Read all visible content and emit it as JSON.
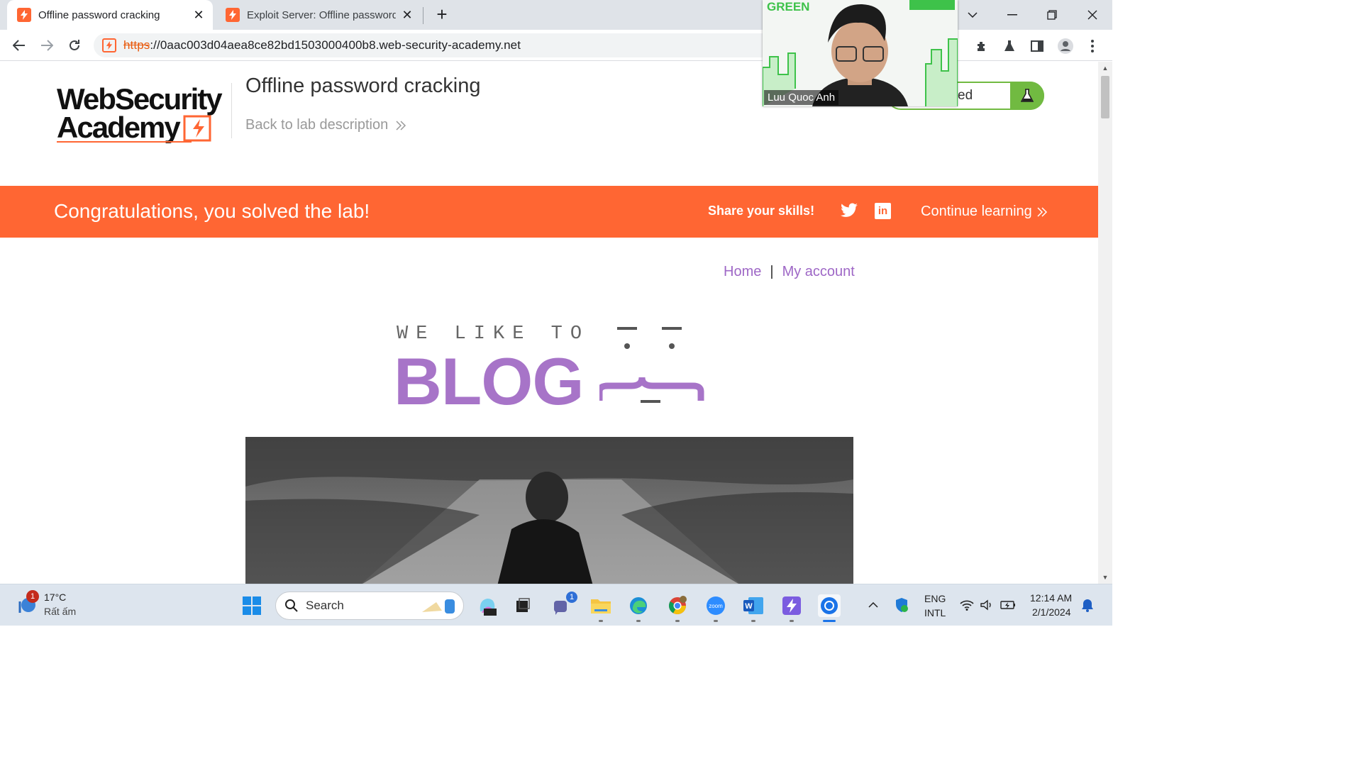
{
  "browser": {
    "tabs": [
      {
        "title": "Offline password cracking",
        "active": true
      },
      {
        "title": "Exploit Server: Offline password c",
        "active": false
      }
    ],
    "url_scheme": "https",
    "url_rest": "://0aac003d04aea8ce82bd1503000400b8.web-security-academy.net"
  },
  "header": {
    "logo_line1": "WebSecurity",
    "logo_line2": "Academy",
    "lab_title": "Offline password cracking",
    "back_link": "Back to lab description",
    "status_label": "ed"
  },
  "banner": {
    "message": "Congratulations, you solved the lab!",
    "share": "Share your skills!",
    "linkedin": "in",
    "continue": "Continue learning"
  },
  "nav": {
    "home": "Home",
    "separator": "|",
    "account": "My account"
  },
  "blog": {
    "tagline": "WE LIKE TO",
    "word": "BLOG"
  },
  "webcam": {
    "name": "Luu Quoc Anh",
    "logo": "GREEN"
  },
  "taskbar": {
    "weather_temp": "17°C",
    "weather_desc": "Rất ấm",
    "weather_badge": "1",
    "search": "Search",
    "teams_badge": "1",
    "lang1": "ENG",
    "lang2": "INTL",
    "time": "12:14 AM",
    "date": "2/1/2024"
  },
  "colors": {
    "brand_orange": "#ff6633",
    "blog_purple": "#a774c8",
    "lab_green": "#71ba41"
  }
}
